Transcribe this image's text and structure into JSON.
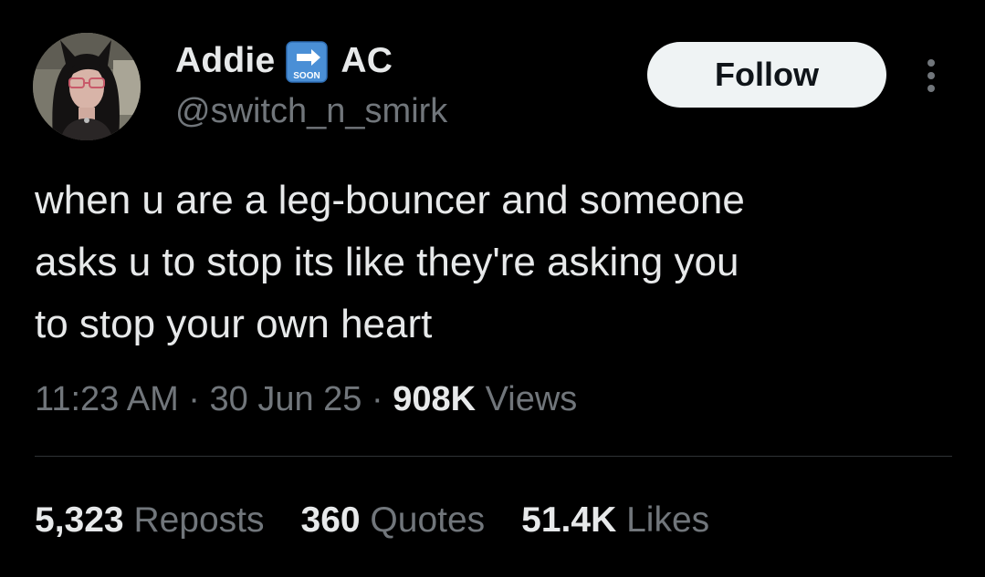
{
  "author": {
    "display_name_first": "Addie",
    "emoji_icon": "soon-arrow-icon",
    "display_name_last": "AC",
    "handle": "@switch_n_smirk"
  },
  "actions": {
    "follow_label": "Follow",
    "more_icon": "more-dots-icon"
  },
  "tweet": {
    "text": "when u are a leg-bouncer and someone\nasks u to stop its like they're asking you\nto stop your own heart"
  },
  "meta": {
    "time": "11:23 AM",
    "sep1": " · ",
    "date": "30 Jun 25",
    "sep2": " · ",
    "views_count": "908K",
    "views_label": " Views"
  },
  "stats": {
    "reposts_count": "5,323",
    "reposts_label": " Reposts",
    "quotes_count": "360",
    "quotes_label": " Quotes",
    "likes_count": "51.4K",
    "likes_label": " Likes"
  },
  "colors": {
    "background": "#000000",
    "primary_text": "#e7e9ea",
    "secondary_text": "#71767b",
    "follow_bg": "#eff3f4",
    "emoji_blue": "#4a8fd6"
  }
}
